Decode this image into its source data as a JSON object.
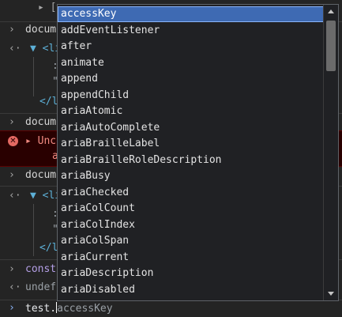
{
  "console": {
    "top_fragment": "▸ [",
    "doc1": "docum",
    "doc1_li": "▼ <li",
    "doc1_colon": ":",
    "doc1_quote": "\"",
    "doc1_close": "</l",
    "doc2": "docum",
    "error_icon": "✕",
    "error_text": "▸ Unca",
    "error_cont": "a",
    "doc3": "docum",
    "doc3_li": "▼ <li",
    "doc3_colon": ":",
    "doc3_quote": "\"",
    "doc3_close": "</l",
    "const_text": "const",
    "undef_text": "undef"
  },
  "prompt": {
    "typed": "test.",
    "suggestion": "accessKey"
  },
  "autocomplete": {
    "selected_index": 0,
    "items": [
      "accessKey",
      "addEventListener",
      "after",
      "animate",
      "append",
      "appendChild",
      "ariaAtomic",
      "ariaAutoComplete",
      "ariaBrailleLabel",
      "ariaBrailleRoleDescription",
      "ariaBusy",
      "ariaChecked",
      "ariaColCount",
      "ariaColIndex",
      "ariaColSpan",
      "ariaCurrent",
      "ariaDescription",
      "ariaDisabled"
    ]
  },
  "colors": {
    "background": "#242424",
    "selected": "#3e6ab3",
    "error_bg": "#290000",
    "error_text": "#f28b82",
    "tag": "#5db0d7"
  }
}
